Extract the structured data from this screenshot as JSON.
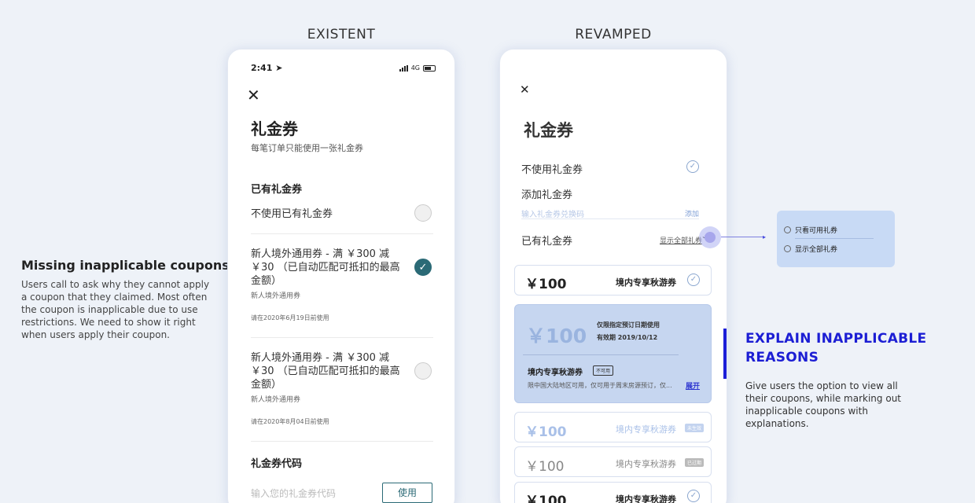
{
  "existent_title": "EXISTENT",
  "revamped_title": "REVAMPED",
  "left_note": {
    "heading": "Missing inapplicable coupons",
    "body": "Users call to ask why they cannot apply a coupon that they claimed. Most often the coupon is inapplicable due to use restrictions. We need to show it right when users apply their coupon."
  },
  "right_note": {
    "heading_line1": "EXPLAIN INAPPLICABLE",
    "heading_line2": "REASONS",
    "body": "Give users the option to view all their coupons, while marking out inapplicable coupons with explanations."
  },
  "existent": {
    "time": "2:41",
    "network": "4G",
    "close": "✕",
    "title": "礼金券",
    "subtitle": "每笔订单只能使用一张礼金券",
    "section_owned": "已有礼金券",
    "no_use": "不使用已有礼金券",
    "coupons": [
      {
        "line1": "新人境外通用券 - 满 ￥300 减",
        "line2": "￥30 （已自动匹配可抵扣的最高",
        "line3": "金额）",
        "type": "新人境外通用券",
        "expiry": "请在2020年6月19日前使用",
        "selected": true
      },
      {
        "line1": "新人境外通用券 - 满 ￥300 减",
        "line2": "￥30 （已自动匹配可抵扣的最高",
        "line3": "金额）",
        "type": "新人境外通用券",
        "expiry": "请在2020年8月04日前使用",
        "selected": false
      }
    ],
    "section_code": "礼金券代码",
    "code_placeholder": "输入您的礼金券代码",
    "use_button": "使用"
  },
  "revamped": {
    "close": "✕",
    "title": "礼金券",
    "no_use": "不使用礼金券",
    "add_coupon": "添加礼金券",
    "add_placeholder": "输入礼金券兑换码",
    "add_link": "添加",
    "owned": "已有礼金券",
    "show_all": "显示全部礼券",
    "coupon1": {
      "amount": "￥100",
      "name": "境内专享秋游券"
    },
    "big_coupon": {
      "amount": "￥100",
      "line1": "仅限指定预订日期使用",
      "line2": "有效期 2019/10/12",
      "name": "境内专享秋游券",
      "tag": "不可用",
      "desc": "限中国大陆地区可用，仅可用于周末房源预订，仅...",
      "expand": "展开"
    },
    "coupon3": {
      "amount": "￥100",
      "name": "境内专享秋游券",
      "tag": "未生效"
    },
    "coupon4": {
      "amount": "￥100",
      "name": "境内专享秋游券",
      "tag": "已过期"
    },
    "coupon5": {
      "amount": "￥100",
      "name": "境内专享秋游券"
    }
  },
  "popup": {
    "option1": "只看可用礼券",
    "option2": "显示全部礼券"
  }
}
